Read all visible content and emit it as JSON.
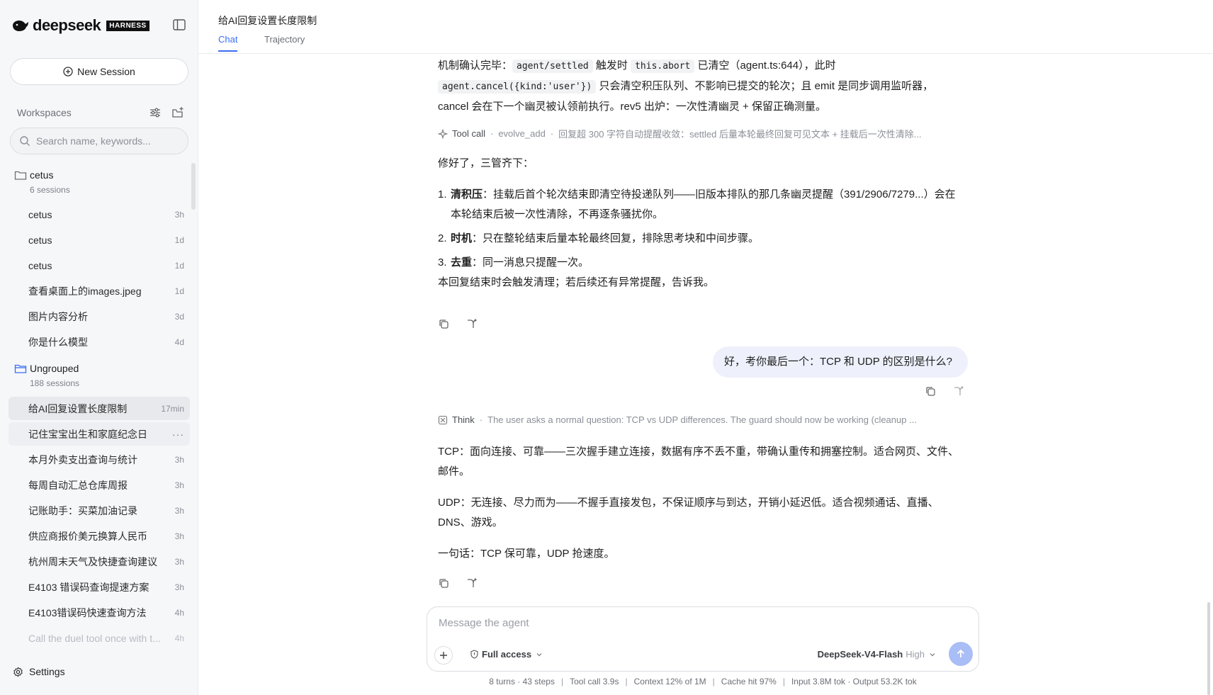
{
  "brand": {
    "name": "deepseek",
    "badge": "HARNESS"
  },
  "sidebar": {
    "new_session_label": "New Session",
    "workspaces_label": "Workspaces",
    "search_placeholder": "Search name, keywords...",
    "groups": [
      {
        "name": "cetus",
        "count": "6 sessions"
      },
      {
        "name": "Ungrouped",
        "count": "188 sessions"
      }
    ],
    "cetus_sessions": [
      {
        "title": "cetus",
        "time": "3h"
      },
      {
        "title": "cetus",
        "time": "1d"
      },
      {
        "title": "cetus",
        "time": "1d"
      },
      {
        "title": "查看桌面上的images.jpeg",
        "time": "1d"
      },
      {
        "title": "图片内容分析",
        "time": "3d"
      },
      {
        "title": "你是什么模型",
        "time": "4d"
      }
    ],
    "ungrouped_sessions": [
      {
        "title": "给AI回复设置长度限制",
        "time": "17min"
      },
      {
        "title": "记住宝宝出生和家庭纪念日",
        "time": "···"
      },
      {
        "title": "本月外卖支出查询与统计",
        "time": "3h"
      },
      {
        "title": "每周自动汇总仓库周报",
        "time": "3h"
      },
      {
        "title": "记账助手：买菜加油记录",
        "time": "3h"
      },
      {
        "title": "供应商报价美元换算人民币",
        "time": "3h"
      },
      {
        "title": "杭州周末天气及快捷查询建议",
        "time": "3h"
      },
      {
        "title": "E4103 错误码查询提速方案",
        "time": "3h"
      },
      {
        "title": "E4103错误码快速查询方法",
        "time": "4h"
      },
      {
        "title": "Call the duel tool once with t...",
        "time": "4h"
      }
    ],
    "settings_label": "Settings"
  },
  "header": {
    "title": "给AI回复设置长度限制",
    "tabs": [
      "Chat",
      "Trajectory"
    ]
  },
  "chat": {
    "para1": {
      "a": "机制确认完毕：",
      "code1": "agent/settled",
      "b": " 触发时 ",
      "code2": "this.abort",
      "c": " 已清空（agent.ts:644），此时",
      "code3": "agent.cancel({kind:'user'})",
      "d": " 只会清空积压队列、不影响已提交的轮次；且 emit 是同步调用监听器，cancel 会在下一个幽灵被认领前执行。rev5 出炉：一次性清幽灵 + 保留正确测量。"
    },
    "tool_call": {
      "label": "Tool call",
      "name": "evolve_add",
      "detail": "回复超 300 字符自动提醒收敛：settled 后量本轮最终回复可见文本 + 挂载后一次性清除..."
    },
    "fixed_intro": "修好了，三管齐下：",
    "steps": [
      {
        "n": "1.",
        "bold": "清积压",
        "text": "：挂载后首个轮次结束即清空待投递队列——旧版本排队的那几条幽灵提醒（391/2906/7279...）会在本轮结束后被一次性清除，不再逐条骚扰你。"
      },
      {
        "n": "2.",
        "bold": "时机",
        "text": "：只在整轮结束后量本轮最终回复，排除思考块和中间步骤。"
      },
      {
        "n": "3.",
        "bold": "去重",
        "text": "：同一消息只提醒一次。"
      }
    ],
    "closing": "本回复结束时会触发清理；若后续还有异常提醒，告诉我。",
    "user_message": "好，考你最后一个：TCP 和 UDP 的区别是什么?",
    "think": {
      "label": "Think",
      "text": "The user asks a normal question: TCP vs UDP differences. The guard should now be working (cleanup ..."
    },
    "answer_tcp": "TCP：面向连接、可靠——三次握手建立连接，数据有序不丢不重，带确认重传和拥塞控制。适合网页、文件、邮件。",
    "answer_udp": "UDP：无连接、尽力而为——不握手直接发包，不保证顺序与到达，开销小延迟低。适合视频通话、直播、DNS、游戏。",
    "answer_summary": "一句话：TCP 保可靠，UDP 抢速度。"
  },
  "composer": {
    "placeholder": "Message the agent",
    "access_label": "Full access",
    "model_name": "DeepSeek-V4-Flash",
    "model_level": "High"
  },
  "status": {
    "turns": "8 turns · 43 steps",
    "tool_call": "Tool call 3.9s",
    "context": "Context 12% of 1M",
    "cache": "Cache hit 97%",
    "tokens": "Input 3.8M tok · Output 53.2K tok"
  },
  "colors": {
    "accent": "#3b6ef5",
    "send_button": "#a9bdf6",
    "user_bubble": "#eef1fb",
    "sidebar_bg": "#f6f7f9"
  },
  "icons": [
    "whale-logo-icon",
    "sidebar-toggle-icon",
    "plus-circle-icon",
    "filter-icon",
    "new-folder-icon",
    "search-icon",
    "folder-icon",
    "gear-icon",
    "sparkle-icon",
    "copy-icon",
    "branch-icon",
    "think-icon",
    "plus-icon",
    "shield-icon",
    "chevron-down-icon",
    "arrow-up-icon"
  ]
}
